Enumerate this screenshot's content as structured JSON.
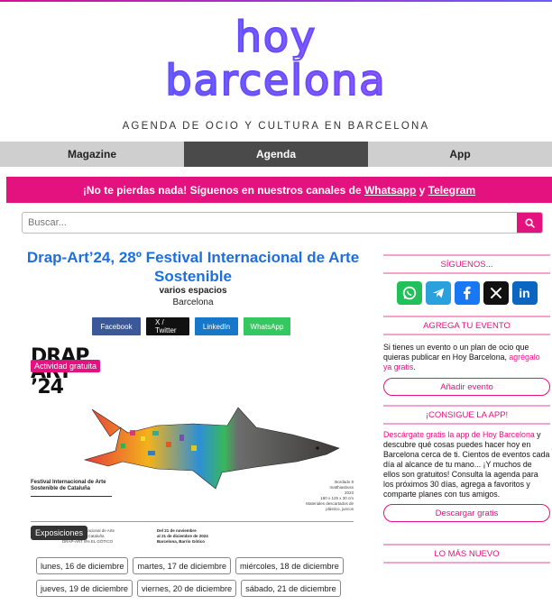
{
  "header": {
    "logo_line1": "hoy",
    "logo_line2": "barcelona",
    "tagline": "AGENDA DE OCIO Y CULTURA EN BARCELONA"
  },
  "nav": {
    "tabs": [
      {
        "label": "Magazine",
        "active": false
      },
      {
        "label": "Agenda",
        "active": true
      },
      {
        "label": "App",
        "active": false
      }
    ]
  },
  "banner": {
    "text_before": "¡No te pierdas nada! Síguenos en nuestros canales de ",
    "whatsapp": "Whatsapp",
    "and": " y ",
    "telegram": "Telegram"
  },
  "search": {
    "placeholder": "Buscar..."
  },
  "event": {
    "title": "Drap-Art’24, 28º Festival Internacional de Arte Sostenible",
    "venue": "varios espacios",
    "city": "Barcelona",
    "share": {
      "facebook": "Facebook",
      "twitter": "X / Twitter",
      "linkedin": "LinkedIn",
      "whatsapp": "WhatsApp"
    },
    "poster": {
      "big_line1": "DRAP",
      "big_line2": "ART",
      "big_line3": "’24",
      "badge_free": "Actividad gratuita",
      "fest_line1": "Festival Internacional de Arte",
      "fest_line2": "Sostenible de Cataluña",
      "artwork_line1": "Bordado 8",
      "artwork_line2": "matthiasbuss",
      "artwork_line3": "2023",
      "artwork_line4": "180 x 125 x 30 cm",
      "artwork_line5": "Materiales descartados de plástico, juncos",
      "venue_small1": "Festival Internacional de Arte",
      "venue_small2": "Sostenible de Cataluña",
      "venue_small3": "DRAP-ART 8% EL GÒTICO",
      "dates_line1": "Del 21 de noviembre",
      "dates_line2": "al 21 de diciembre de 2024",
      "dates_line3": "Barcelona, Barrio Gótico",
      "badge_category": "Exposiciones"
    },
    "days": [
      "lunes, 16 de diciembre",
      "martes, 17 de diciembre",
      "miércoles, 18 de diciembre",
      "jueves, 19 de diciembre",
      "viernes, 20 de diciembre",
      "sábado, 21 de diciembre"
    ]
  },
  "sidebar": {
    "follow_title": "SÍGUENOS...",
    "social": [
      "whatsapp-icon",
      "telegram-icon",
      "facebook-icon",
      "x-icon",
      "linkedin-icon"
    ],
    "add_title": "AGREGA TU EVENTO",
    "add_text_before": "Si tienes un evento o un plan de ocio que quieras publicar en Hoy Barcelona, ",
    "add_text_link": "agrégalo ya gratis",
    "add_text_after": ".",
    "add_button": "Añadir evento",
    "app_title": "¡CONSIGUE LA APP!",
    "app_text_link": "Descárgate gratis la app de Hoy Barcelona",
    "app_text_rest": " y descubre qué cosas puedes hacer hoy en Barcelona cerca de ti. Cientos de eventos cada día al alcance de tu mano... ¡Y muchos de ellos son gratuitos! Consulta la agenda para los próximos 30 días, agrega a favoritos y comparte planes con tus amigos.",
    "app_button": "Descargar gratis",
    "latest_title": "LO MÁS NUEVO"
  },
  "colors": {
    "accent": "#e4127f",
    "title_blue": "#1d6fe0",
    "nav_active": "#4a4a4a"
  }
}
